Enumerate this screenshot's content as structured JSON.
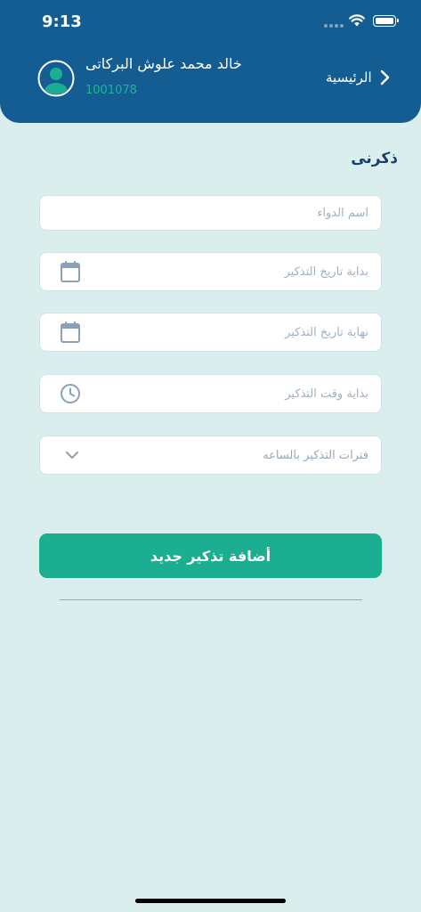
{
  "status_bar": {
    "time": "9:13"
  },
  "header": {
    "user_name": "خالد محمد علوش البركاتى",
    "user_id": "1001078",
    "home_label": "الرئيسية"
  },
  "page": {
    "title": "ذكرنى"
  },
  "form": {
    "medicine_name_placeholder": "اسم الدواء",
    "start_date_placeholder": "بداية تاريخ التذكير",
    "end_date_placeholder": "نهاية تاريخ التذكير",
    "start_time_placeholder": "بداية وقت التذكير",
    "interval_placeholder": "فترات التذكير بالساعه"
  },
  "actions": {
    "add_button_label": "أضافة تذكير جديد"
  },
  "icons": {
    "wifi": "wifi-icon",
    "battery": "battery-icon",
    "avatar": "user-avatar-icon",
    "home": "chevron-right-icon",
    "start_date": "calendar-icon",
    "end_date": "calendar-icon",
    "start_time": "clock-icon",
    "interval": "chevron-down-icon"
  },
  "colors": {
    "header_bg": "#135d92",
    "page_bg": "#d9eeed",
    "accent": "#1bae90",
    "title": "#16406b",
    "icon": "#8aa1b7"
  }
}
